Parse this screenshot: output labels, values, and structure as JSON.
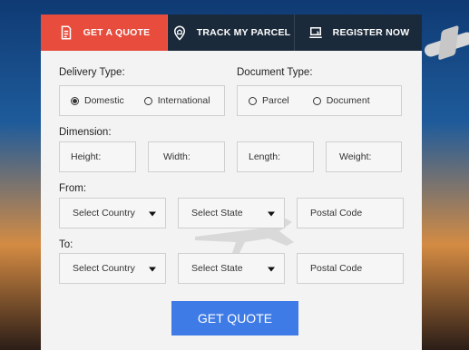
{
  "tabs": [
    {
      "label": "GET A QUOTE",
      "icon": "document-icon",
      "active": true
    },
    {
      "label": "TRACK MY PARCEL",
      "icon": "location-pin-icon",
      "active": false
    },
    {
      "label": "REGISTER NOW",
      "icon": "laptop-icon",
      "active": false
    }
  ],
  "form": {
    "delivery_type": {
      "label": "Delivery Type:",
      "options": [
        {
          "label": "Domestic",
          "checked": true
        },
        {
          "label": "International",
          "checked": false
        }
      ]
    },
    "document_type": {
      "label": "Document Type:",
      "options": [
        {
          "label": "Parcel",
          "checked": false
        },
        {
          "label": "Document",
          "checked": false
        }
      ]
    },
    "dimension": {
      "label": "Dimension:",
      "fields": [
        {
          "placeholder": "Height:"
        },
        {
          "placeholder": "Width:"
        },
        {
          "placeholder": "Length:"
        },
        {
          "placeholder": "Weight:"
        }
      ]
    },
    "from": {
      "label": "From:",
      "country": "Select Country",
      "state": "Select State",
      "postal": "Postal Code"
    },
    "to": {
      "label": "To:",
      "country": "Select Country",
      "state": "Select State",
      "postal": "Postal Code"
    },
    "submit_label": "GET QUOTE"
  },
  "colors": {
    "active_tab": "#e74c3c",
    "tab_bar": "#1b2a3a",
    "primary_button": "#3f7be6"
  }
}
